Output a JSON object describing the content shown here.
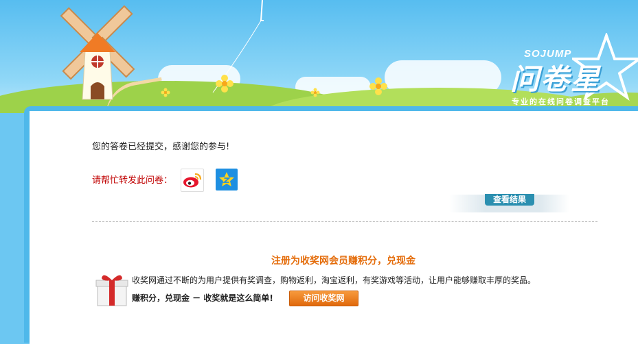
{
  "header": {
    "logo_en": "SOJUMP",
    "logo_cn": "问卷星",
    "logo_tagline": "专业的在线问卷调查平台"
  },
  "message": {
    "thanks": "您的答卷已经提交，感谢您的参与!",
    "share_label": "请帮忙转发此问卷："
  },
  "share": {
    "weibo_icon": "weibo-icon",
    "qzone_icon": "qzone-icon"
  },
  "result_button_label": "查看结果",
  "promo": {
    "title": "注册为收奖网会员赚积分，兑现金",
    "description": "收奖网通过不断的为用户提供有奖调查，购物返利，淘宝返利，有奖游戏等活动，让用户能够赚取丰厚的奖品。",
    "slogan": "赚积分，兑现金 － 收奖就是这么简单!",
    "visit_button_label": "访问收奖网",
    "gift_icon": "gift-icon"
  },
  "colors": {
    "accent_orange": "#e46c0a",
    "share_red": "#c00000",
    "frame_blue": "#4fb8ea"
  }
}
